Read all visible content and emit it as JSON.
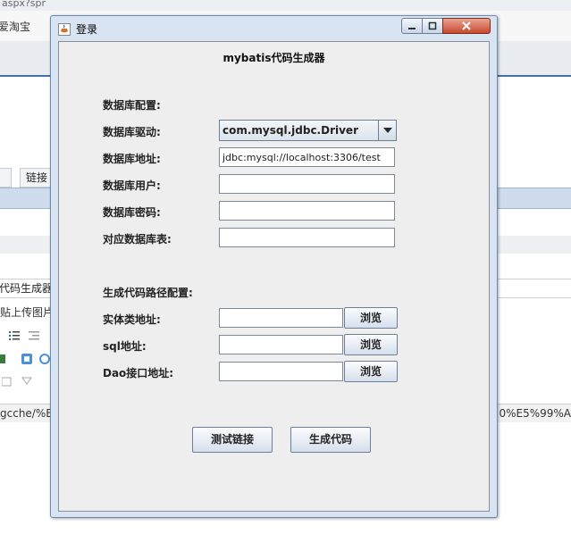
{
  "background": {
    "top_partial": "aspx?spr",
    "bookmark": "爱淘宝",
    "tab_partial": "链接",
    "editor_title_partial": "代码生成器",
    "editor_hint_partial": "贴上传图片",
    "status_left": "gcche/%E",
    "status_right": "0%E5%99%A"
  },
  "window": {
    "title": "登录",
    "heading": "mybatis代码生成器",
    "db_section_label": "数据库配置:",
    "driver_label": "数据库驱动:",
    "driver_value": "com.mysql.jdbc.Driver",
    "url_label": "数据库地址:",
    "url_value": "jdbc:mysql://localhost:3306/test",
    "user_label": "数据库用户:",
    "user_value": "",
    "password_label": "数据库密码:",
    "password_value": "",
    "table_label": "对应数据库表:",
    "table_value": "",
    "gen_section_label": "生成代码路径配置:",
    "entity_label": "实体类地址:",
    "entity_value": "",
    "sql_label": "sql地址:",
    "sql_value": "",
    "dao_label": "Dao接口地址:",
    "dao_value": "",
    "browse_label": "浏览",
    "test_button": "测试链接",
    "generate_button": "生成代码"
  }
}
